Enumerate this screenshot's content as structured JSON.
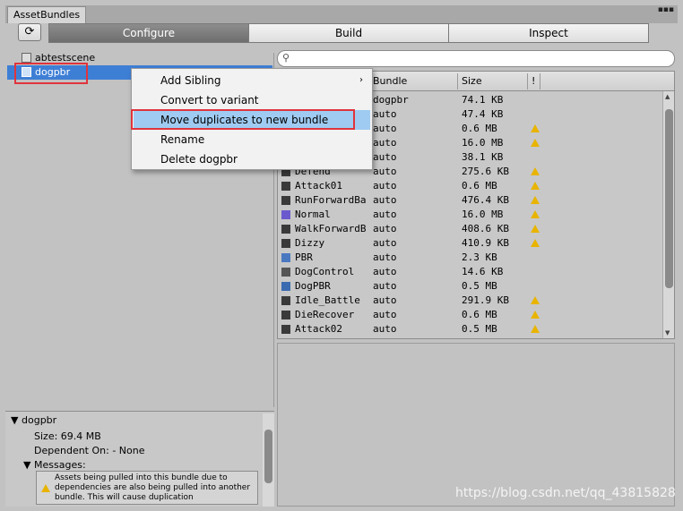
{
  "window": {
    "tab_title": "AssetBundles",
    "menu_glyph": "▪▪▪"
  },
  "toolbar": {
    "refresh_glyph": "⟳",
    "tabs": [
      {
        "label": "Configure"
      },
      {
        "label": "Build"
      },
      {
        "label": "Inspect"
      }
    ]
  },
  "tree": {
    "items": [
      {
        "label": "abtestscene",
        "icon": "scene-icon"
      },
      {
        "label": "dogpbr",
        "icon": "bundle-icon"
      }
    ]
  },
  "context_menu": {
    "items": [
      {
        "label": "Add Sibling",
        "arrow": "›"
      },
      {
        "label": "Convert to variant"
      },
      {
        "label": "Move duplicates to new bundle"
      },
      {
        "label": "Rename"
      },
      {
        "label": "Delete dogpbr"
      }
    ]
  },
  "search": {
    "placeholder": ""
  },
  "grid": {
    "headers": {
      "bundle": "Bundle",
      "size": "Size",
      "warn": "!"
    },
    "rows": [
      {
        "name": "",
        "bundle": "dogpbr",
        "size": "74.1 KB",
        "warn": false,
        "icon": "#3a3a3a"
      },
      {
        "name": "",
        "bundle": "auto",
        "size": "47.4 KB",
        "warn": false,
        "icon": "#3a3a3a"
      },
      {
        "name": "",
        "bundle": "auto",
        "size": "0.6 MB",
        "warn": true,
        "icon": "#3a3a3a"
      },
      {
        "name": "",
        "bundle": "auto",
        "size": "16.0 MB",
        "warn": true,
        "icon": "#3a3a3a"
      },
      {
        "name": "",
        "bundle": "auto",
        "size": "38.1 KB",
        "warn": false,
        "icon": "#3a3a3a"
      },
      {
        "name": "Defend",
        "bundle": "auto",
        "size": "275.6 KB",
        "warn": true,
        "icon": "#3a3a3a"
      },
      {
        "name": "Attack01",
        "bundle": "auto",
        "size": "0.6 MB",
        "warn": true,
        "icon": "#3a3a3a"
      },
      {
        "name": "RunForwardBa",
        "bundle": "auto",
        "size": "476.4 KB",
        "warn": true,
        "icon": "#3a3a3a"
      },
      {
        "name": "Normal",
        "bundle": "auto",
        "size": "16.0 MB",
        "warn": true,
        "icon": "#6a5acd"
      },
      {
        "name": "WalkForwardB",
        "bundle": "auto",
        "size": "408.6 KB",
        "warn": true,
        "icon": "#3a3a3a"
      },
      {
        "name": "Dizzy",
        "bundle": "auto",
        "size": "410.9 KB",
        "warn": true,
        "icon": "#3a3a3a"
      },
      {
        "name": "PBR",
        "bundle": "auto",
        "size": "2.3 KB",
        "warn": false,
        "icon": "#4a78c0"
      },
      {
        "name": "DogControl",
        "bundle": "auto",
        "size": "14.6 KB",
        "warn": false,
        "icon": "#555555"
      },
      {
        "name": "DogPBR",
        "bundle": "auto",
        "size": "0.5 MB",
        "warn": false,
        "icon": "#3a6ab0"
      },
      {
        "name": "Idle_Battle",
        "bundle": "auto",
        "size": "291.9 KB",
        "warn": true,
        "icon": "#3a3a3a"
      },
      {
        "name": "DieRecover",
        "bundle": "auto",
        "size": "0.6 MB",
        "warn": true,
        "icon": "#3a3a3a"
      },
      {
        "name": "Attack02",
        "bundle": "auto",
        "size": "0.5 MB",
        "warn": true,
        "icon": "#3a3a3a"
      }
    ]
  },
  "details": {
    "title": "dogpbr",
    "size": "Size: 69.4 MB",
    "dependent": "Dependent On: - None",
    "messages_label": "Messages:",
    "message": "Assets being pulled into this bundle due to dependencies are also being pulled into another bundle.  This will cause duplication"
  },
  "watermark": "https://blog.csdn.net/qq_43815828",
  "colors": {
    "selection": "#3e7fd6",
    "highlight": "#9fcbf2",
    "warning": "#e8b400",
    "annotation": "#e0343c"
  }
}
